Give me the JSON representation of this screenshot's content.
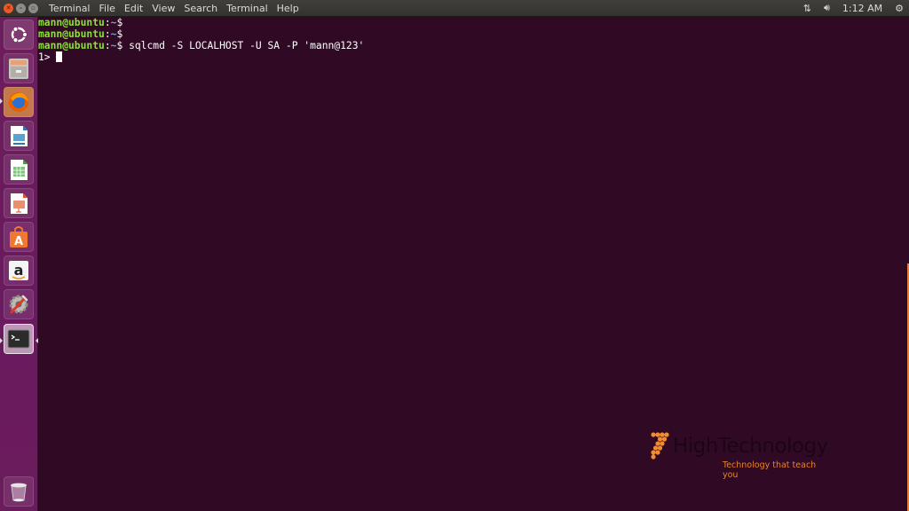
{
  "topbar": {
    "app_name": "Terminal",
    "menu": [
      "File",
      "Edit",
      "View",
      "Search",
      "Terminal",
      "Help"
    ],
    "window_buttons": [
      "close",
      "minimize",
      "maximize"
    ],
    "indicators": {
      "network_icon": "network-updown-icon",
      "volume_icon": "volume-icon",
      "clock": "1:12 AM",
      "system_icon": "gear-icon"
    }
  },
  "launcher": {
    "items": [
      {
        "name": "ubuntu-dash",
        "icon": "ubuntu-logo-icon"
      },
      {
        "name": "files",
        "icon": "file-cabinet-icon"
      },
      {
        "name": "firefox",
        "icon": "firefox-icon",
        "running": true
      },
      {
        "name": "libreoffice-writer",
        "icon": "writer-icon"
      },
      {
        "name": "libreoffice-calc",
        "icon": "calc-icon"
      },
      {
        "name": "libreoffice-impress",
        "icon": "impress-icon"
      },
      {
        "name": "ubuntu-software",
        "icon": "software-center-icon"
      },
      {
        "name": "amazon",
        "icon": "amazon-icon"
      },
      {
        "name": "system-settings",
        "icon": "settings-icon"
      },
      {
        "name": "terminal",
        "icon": "terminal-icon",
        "running": true,
        "focused": true
      },
      {
        "name": "trash",
        "icon": "trash-icon"
      }
    ]
  },
  "terminal": {
    "lines": [
      {
        "user": "mann@ubuntu",
        "path": "~",
        "prompt": "$",
        "command": ""
      },
      {
        "user": "mann@ubuntu",
        "path": "~",
        "prompt": "$",
        "command": ""
      },
      {
        "user": "mann@ubuntu",
        "path": "~",
        "prompt": "$",
        "command": " sqlcmd -S LOCALHOST -U SA -P 'mann@123'"
      }
    ],
    "sqlcmd_prompt": "1> "
  },
  "watermark": {
    "title": "HighTechnology",
    "subtitle": "Technology that teach you",
    "accent_color": "#e8832a"
  },
  "colors": {
    "terminal_bg": "#300a24",
    "user_green": "#8ae234",
    "path_blue": "#729fcf",
    "launcher_bg": "#6b1c5d"
  }
}
